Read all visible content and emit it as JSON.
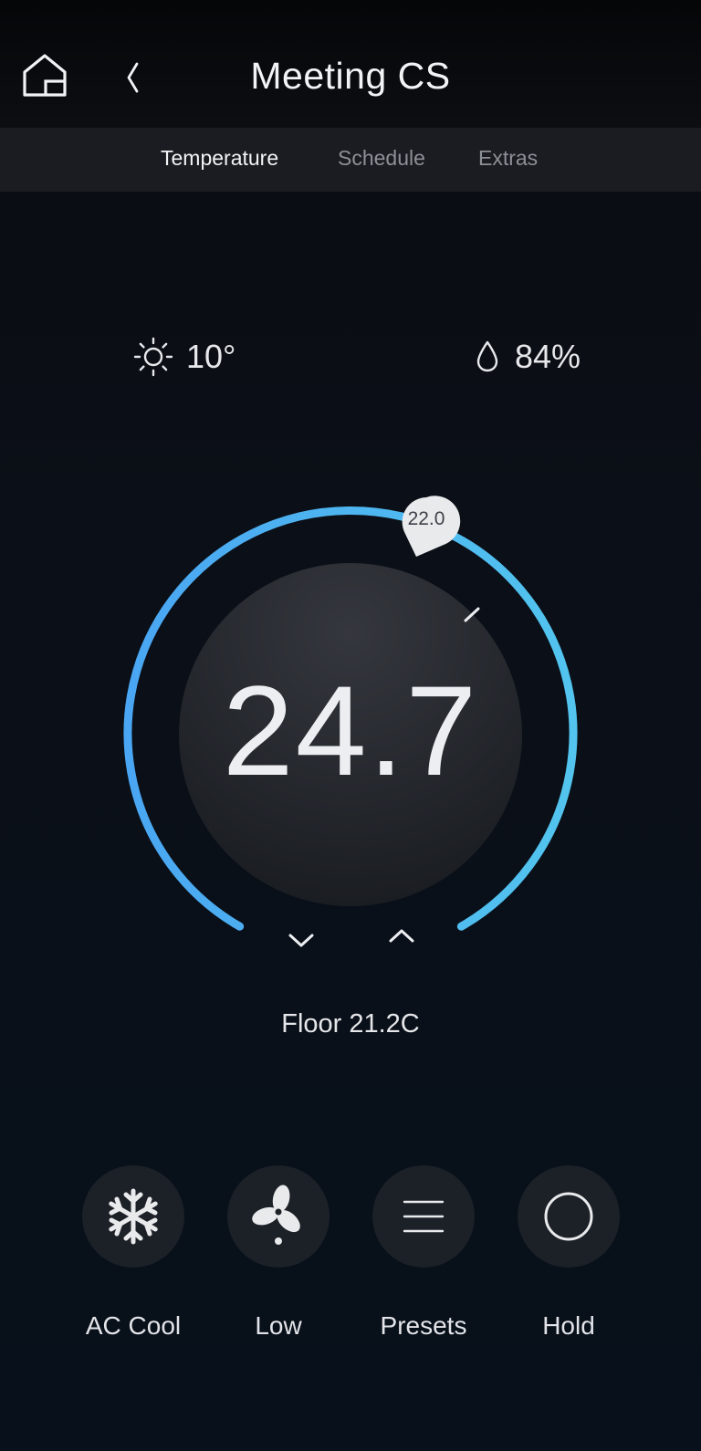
{
  "header": {
    "title": "Meeting CS",
    "home_icon": "home-icon",
    "back_icon": "chevron-left-icon"
  },
  "tabs": [
    {
      "label": "Temperature",
      "active": true
    },
    {
      "label": "Schedule",
      "active": false
    },
    {
      "label": "Extras",
      "active": false
    }
  ],
  "weather": {
    "outdoor_temp": "10°",
    "outdoor_icon": "sun-icon",
    "humidity": "84%",
    "humidity_icon": "droplet-icon"
  },
  "thermostat": {
    "current_temp": "24.7",
    "setpoint": "22.0",
    "floor_temp": "Floor 21.2C",
    "arc_color_start": "#4aa6f2",
    "arc_color_end": "#52c4ee"
  },
  "controls": [
    {
      "label": "AC Cool",
      "icon": "snowflake-icon"
    },
    {
      "label": "Low",
      "icon": "fan-icon"
    },
    {
      "label": "Presets",
      "icon": "menu-lines-icon"
    },
    {
      "label": "Hold",
      "icon": "circle-icon"
    }
  ]
}
